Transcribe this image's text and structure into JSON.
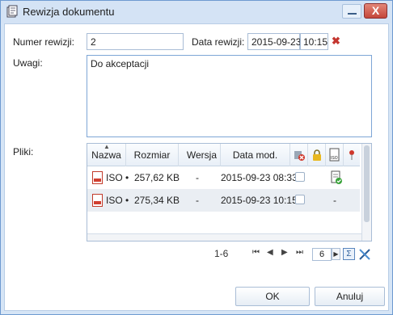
{
  "window": {
    "title": "Rewizja dokumentu",
    "close_glyph": "X"
  },
  "form": {
    "revision_number_label": "Numer rewizji:",
    "revision_number_value": "2",
    "revision_date_label": "Data rewizji:",
    "revision_date_value": "2015-09-23",
    "revision_time_value": "10:15",
    "notes_label": "Uwagi:",
    "notes_value": "Do akceptacji",
    "files_label": "Pliki:"
  },
  "grid": {
    "columns": [
      "Nazwa",
      "Rozmiar",
      "Wersja",
      "Data mod."
    ],
    "icon_columns": [
      "remove-file-icon",
      "lock-icon",
      "iso-document-icon",
      "pin-icon"
    ],
    "rows": [
      {
        "name": "ISO •",
        "size": "257,62 KB",
        "version": "-",
        "date": "2015-09-23 08:33",
        "iso": "approved-icon"
      },
      {
        "name": "ISO •",
        "size": "275,34 KB",
        "version": "-",
        "date": "2015-09-23 10:15",
        "iso": "-"
      }
    ]
  },
  "pager": {
    "range": "1-6",
    "page": "6"
  },
  "buttons": {
    "ok": "OK",
    "cancel": "Anuluj"
  },
  "colors": {
    "titlebar": "#d4e3f5",
    "close_button": "#c4463a",
    "accent_border": "#7ea6d6"
  }
}
